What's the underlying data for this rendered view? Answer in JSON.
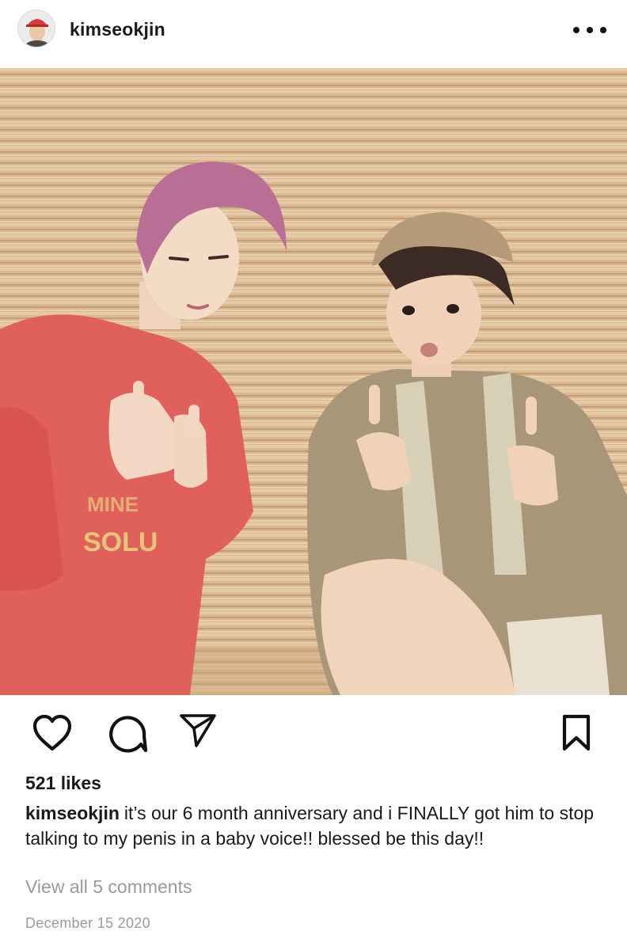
{
  "header": {
    "username": "kimseokjin",
    "more_icon": "more-horizontal-icon"
  },
  "post": {
    "image_icon": "photo"
  },
  "actions": {
    "like_icon": "heart-icon",
    "comment_icon": "comment-icon",
    "share_icon": "paper-plane-icon",
    "save_icon": "bookmark-icon"
  },
  "likes": "521 likes",
  "caption": {
    "username": "kimseokjin",
    "text": "it’s our 6 month anniversary and i FINALLY got him to stop talking to my penis in a baby voice!! blessed be this day!!"
  },
  "view_comments": "View all 5 comments",
  "date": "December 15 2020",
  "colors": {
    "text": "#1a1a1a",
    "muted": "#9a9a9a",
    "background": "#ffffff"
  }
}
